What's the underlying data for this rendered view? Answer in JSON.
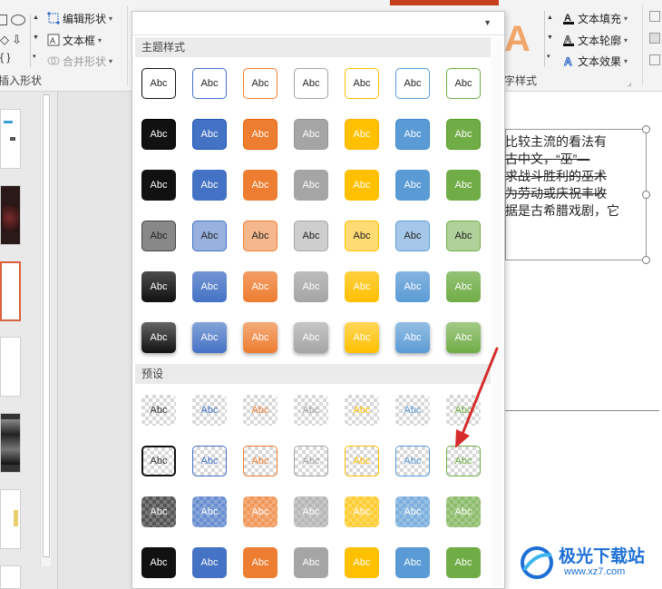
{
  "ribbon": {
    "edit_shape": "编辑形状",
    "text_box": "文本框",
    "merge_shapes": "合并形状",
    "insert_shapes_group": "插入形状",
    "art_styles_group": "字样式",
    "text_fill": "文本填充",
    "text_outline": "文本轮廓",
    "text_effects": "文本效果"
  },
  "dropdown": {
    "theme_styles_header": "主题样式",
    "presets_header": "预设",
    "swatch_label": "Abc"
  },
  "swatch_colors": {
    "dark": "#111111",
    "blue": "#4472c4",
    "orange": "#ed7d31",
    "gray": "#a5a5a5",
    "gold": "#ffc000",
    "lightblue": "#5b9bd5",
    "green": "#70ad47"
  },
  "slide": {
    "lines": [
      {
        "text": "比较主流的看法有",
        "style": "normal"
      },
      {
        "text": "古中文，“巫”—",
        "style": "strike"
      },
      {
        "text": "求战斗胜利的巫术",
        "style": "strike"
      },
      {
        "text": "为劳动或庆祝丰收",
        "style": "strike"
      },
      {
        "text": "据是古希腊戏剧，它",
        "style": "normal"
      }
    ]
  },
  "watermark": {
    "title": "极光下载站",
    "url": "www.xz7.com"
  }
}
